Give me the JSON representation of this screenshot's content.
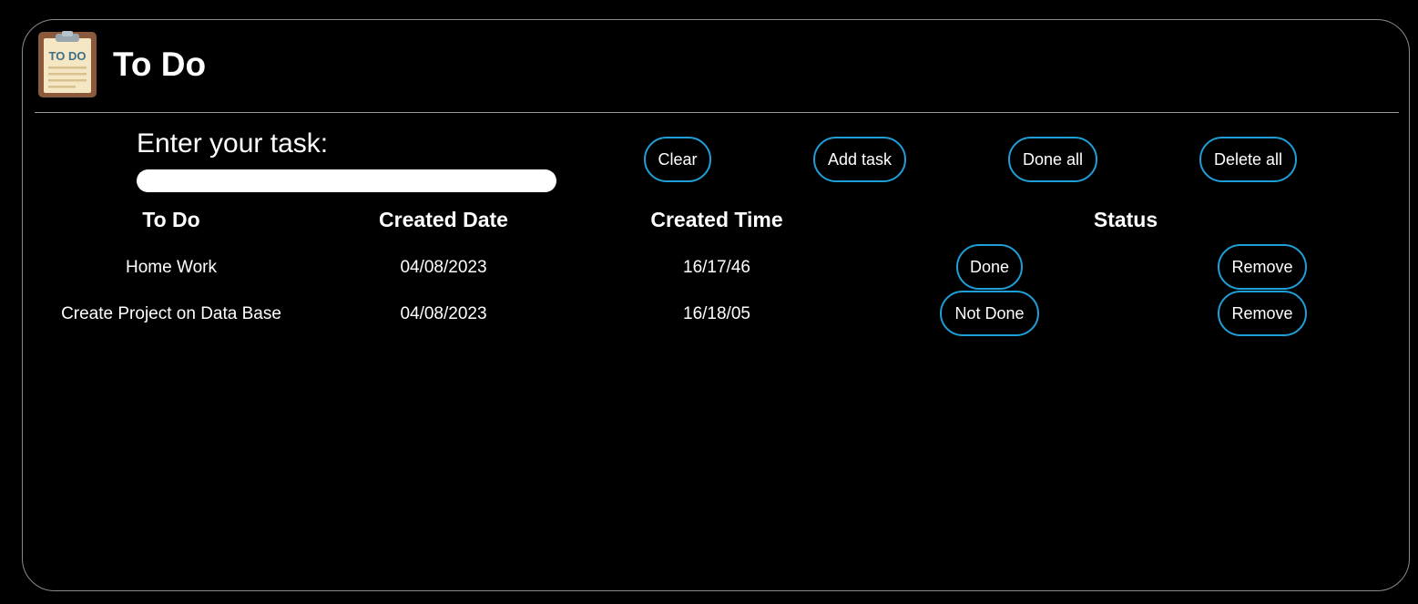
{
  "app": {
    "title": "To Do",
    "logo_icon": "todo-clipboard-icon",
    "logo_text": "TO DO"
  },
  "input": {
    "label": "Enter your task:",
    "value": "",
    "placeholder": ""
  },
  "toolbar": {
    "clear_label": "Clear",
    "add_label": "Add task",
    "done_all_label": "Done all",
    "delete_all_label": "Delete all"
  },
  "table": {
    "headers": [
      "To Do",
      "Created Date",
      "Created Time",
      "Status"
    ],
    "rows": [
      {
        "task": "Home Work",
        "date": "04/08/2023",
        "time": "16/17/46",
        "status_button": "Done",
        "remove_button": "Remove"
      },
      {
        "task": "Create Project on Data Base",
        "date": "04/08/2023",
        "time": "16/18/05",
        "status_button": "Not Done",
        "remove_button": "Remove"
      }
    ]
  },
  "colors": {
    "background": "#000000",
    "accent_border": "#1e9fd8",
    "frame_border": "#8a8a8a",
    "text": "#ffffff"
  }
}
